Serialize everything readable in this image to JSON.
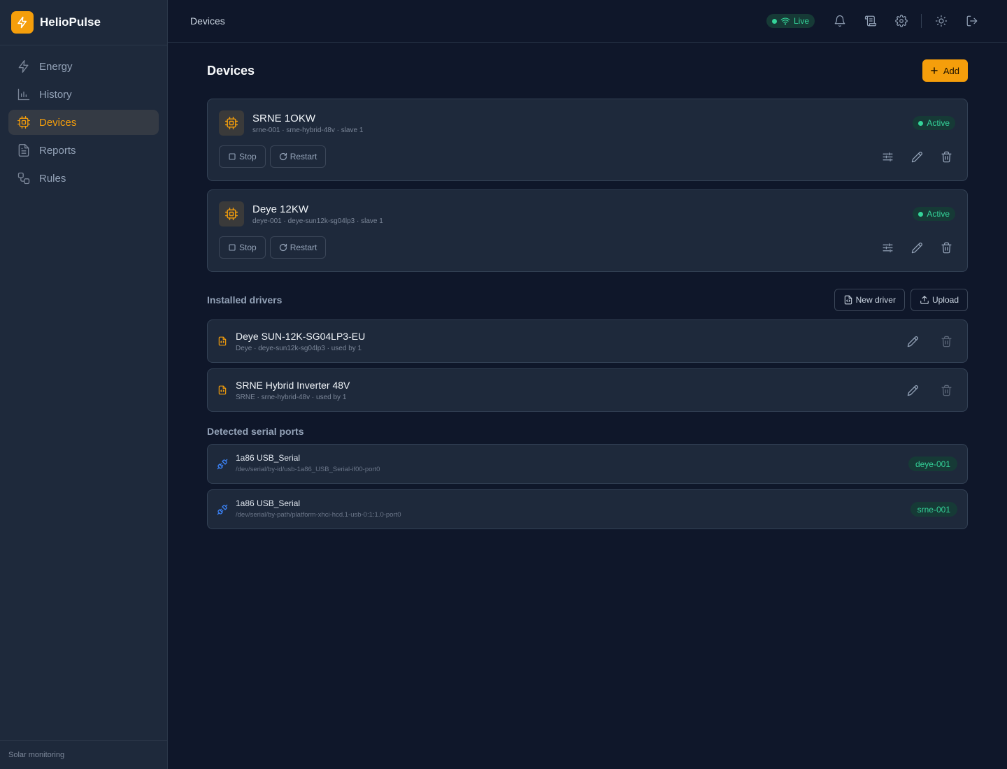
{
  "app": {
    "name": "HelioPulse",
    "footer": "Solar monitoring"
  },
  "nav": [
    {
      "label": "Energy",
      "icon": "bolt-icon",
      "active": false
    },
    {
      "label": "History",
      "icon": "bar-chart-icon",
      "active": false
    },
    {
      "label": "Devices",
      "icon": "chip-icon",
      "active": true
    },
    {
      "label": "Reports",
      "icon": "document-icon",
      "active": false
    },
    {
      "label": "Rules",
      "icon": "workflow-icon",
      "active": false
    }
  ],
  "topbar": {
    "title": "Devices",
    "live_label": "Live",
    "icons": [
      "bell-icon",
      "scroll-icon",
      "gear-icon",
      "sun-icon",
      "logout-icon"
    ]
  },
  "page": {
    "title": "Devices",
    "add_label": "Add"
  },
  "devices": [
    {
      "name": "SRNE 1OKW",
      "meta": "srne-001 · srne-hybrid-48v · slave 1",
      "status": "Active",
      "stop_label": "Stop",
      "restart_label": "Restart"
    },
    {
      "name": "Deye 12KW",
      "meta": "deye-001 · deye-sun12k-sg04lp3 · slave 1",
      "status": "Active",
      "stop_label": "Stop",
      "restart_label": "Restart"
    }
  ],
  "drivers_section": {
    "title": "Installed drivers",
    "new_driver_label": "New driver",
    "upload_label": "Upload"
  },
  "drivers": [
    {
      "name": "Deye SUN-12K-SG04LP3-EU",
      "meta": "Deye · deye-sun12k-sg04lp3 · used by 1"
    },
    {
      "name": "SRNE Hybrid Inverter 48V",
      "meta": "SRNE · srne-hybrid-48v · used by 1"
    }
  ],
  "ports_section": {
    "title": "Detected serial ports"
  },
  "ports": [
    {
      "name": "1a86 USB_Serial",
      "path": "/dev/serial/by-id/usb-1a86_USB_Serial-if00-port0",
      "device": "deye-001"
    },
    {
      "name": "1a86 USB_Serial",
      "path": "/dev/serial/by-path/platform-xhci-hcd.1-usb-0:1:1.0-port0",
      "device": "srne-001"
    }
  ],
  "colors": {
    "accent": "#f59e0b",
    "success": "#34d399",
    "background": "#0f172a",
    "card": "#1e293b",
    "link_icon": "#3b82f6"
  }
}
